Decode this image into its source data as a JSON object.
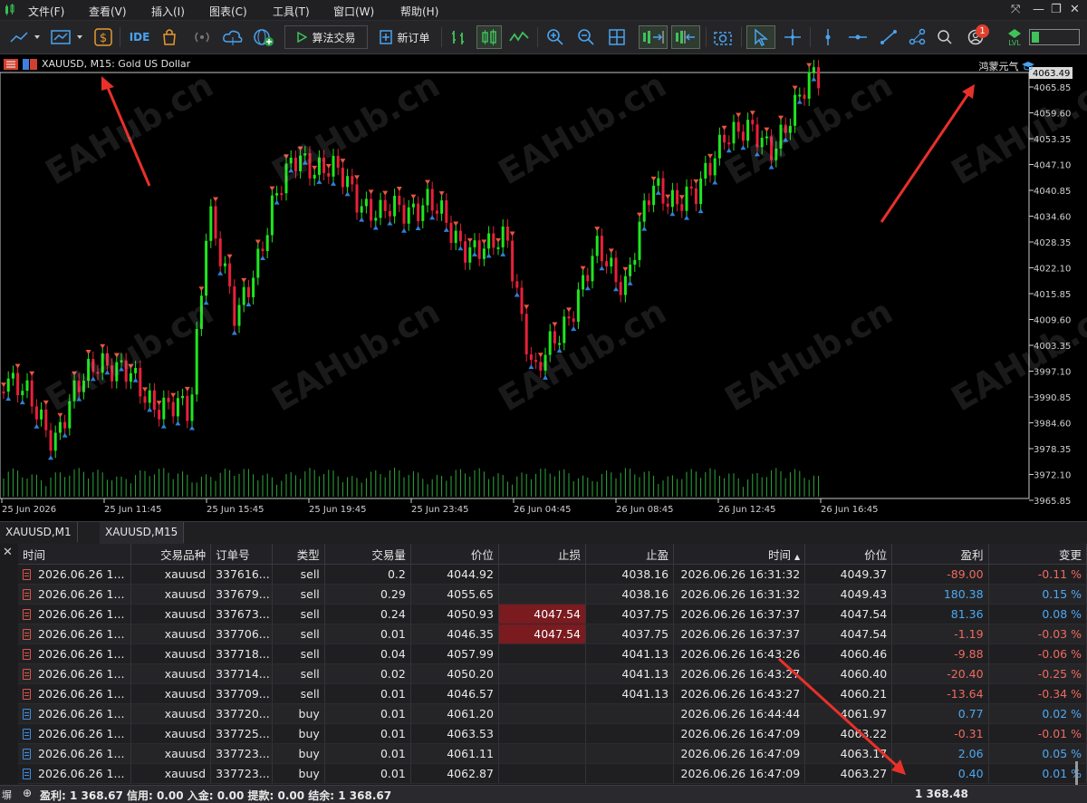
{
  "menubar": {
    "items": [
      "文件(F)",
      "查看(V)",
      "插入(I)",
      "图表(C)",
      "工具(T)",
      "窗口(W)",
      "帮助(H)"
    ]
  },
  "toolbar": {
    "ide_label": "IDE",
    "algo_label": "算法交易",
    "new_order_label": "新订单",
    "notification_count": "1",
    "lvl_label": "LVL"
  },
  "chart": {
    "symbol_line": "XAUUSD, M15:  Gold US Dollar",
    "ea_name": "鸿蒙元气",
    "current_price": "4063.49",
    "watermark": "EAHub.cn",
    "colors": {
      "bull": "#1ee61e",
      "bear": "#e8203a",
      "buy_arrow": "#2f7fd8",
      "sell_arrow": "#e8553f",
      "price_axis": "#d0d0d0"
    },
    "price_labels": [
      "4065.85",
      "4059.60",
      "4053.35",
      "4047.10",
      "4040.85",
      "4034.60",
      "4028.35",
      "4022.10",
      "4015.85",
      "4009.60",
      "4003.35",
      "3997.10",
      "3990.85",
      "3984.60",
      "3978.35",
      "3972.10",
      "3965.85"
    ],
    "time_labels": [
      "25 Jun 2026",
      "25 Jun 11:45",
      "25 Jun 15:45",
      "25 Jun 19:45",
      "25 Jun 23:45",
      "26 Jun 04:45",
      "26 Jun 08:45",
      "26 Jun 12:45",
      "26 Jun 16:45"
    ]
  },
  "tabs": [
    "XAUUSD,M1",
    "XAUUSD,M15"
  ],
  "trade": {
    "columns": [
      "时间",
      "交易品种",
      "订单号",
      "类型",
      "交易量",
      "价位",
      "止损",
      "止盈",
      "时间",
      "价位",
      "盈利",
      "变更"
    ],
    "rows": [
      [
        "2026.06.26 1...",
        "xauusd",
        "337616...",
        "sell",
        "0.2",
        "4044.92",
        "",
        "4038.16",
        "2026.06.26 16:31:32",
        "4049.37",
        "-89.00",
        "-0.11 %"
      ],
      [
        "2026.06.26 1...",
        "xauusd",
        "337679...",
        "sell",
        "0.29",
        "4055.65",
        "",
        "4038.16",
        "2026.06.26 16:31:32",
        "4049.43",
        "180.38",
        "0.15 %"
      ],
      [
        "2026.06.26 1...",
        "xauusd",
        "337673...",
        "sell",
        "0.24",
        "4050.93",
        "4047.54",
        "4037.75",
        "2026.06.26 16:37:37",
        "4047.54",
        "81.36",
        "0.08 %"
      ],
      [
        "2026.06.26 1...",
        "xauusd",
        "337706...",
        "sell",
        "0.01",
        "4046.35",
        "4047.54",
        "4037.75",
        "2026.06.26 16:37:37",
        "4047.54",
        "-1.19",
        "-0.03 %"
      ],
      [
        "2026.06.26 1...",
        "xauusd",
        "337718...",
        "sell",
        "0.04",
        "4057.99",
        "",
        "4041.13",
        "2026.06.26 16:43:26",
        "4060.46",
        "-9.88",
        "-0.06 %"
      ],
      [
        "2026.06.26 1...",
        "xauusd",
        "337714...",
        "sell",
        "0.02",
        "4050.20",
        "",
        "4041.13",
        "2026.06.26 16:43:27",
        "4060.40",
        "-20.40",
        "-0.25 %"
      ],
      [
        "2026.06.26 1...",
        "xauusd",
        "337709...",
        "sell",
        "0.01",
        "4046.57",
        "",
        "4041.13",
        "2026.06.26 16:43:27",
        "4060.21",
        "-13.64",
        "-0.34 %"
      ],
      [
        "2026.06.26 1...",
        "xauusd",
        "337720...",
        "buy",
        "0.01",
        "4061.20",
        "",
        "",
        "2026.06.26 16:44:44",
        "4061.97",
        "0.77",
        "0.02 %"
      ],
      [
        "2026.06.26 1...",
        "xauusd",
        "337725...",
        "buy",
        "0.01",
        "4063.53",
        "",
        "",
        "2026.06.26 16:47:09",
        "4063.22",
        "-0.31",
        "-0.01 %"
      ],
      [
        "2026.06.26 1...",
        "xauusd",
        "337723...",
        "buy",
        "0.01",
        "4061.11",
        "",
        "",
        "2026.06.26 16:47:09",
        "4063.17",
        "2.06",
        "0.05 %"
      ],
      [
        "2026.06.26 1...",
        "xauusd",
        "337723...",
        "buy",
        "0.01",
        "4062.87",
        "",
        "",
        "2026.06.26 16:47:09",
        "4063.27",
        "0.40",
        "0.01 %"
      ]
    ],
    "summary_text": "盈利: 1 368.67  信用: 0.00  入金: 0.00  提款: 0.00  结余: 1 368.67",
    "summary_total": "1 368.48",
    "side_label": "塀"
  }
}
